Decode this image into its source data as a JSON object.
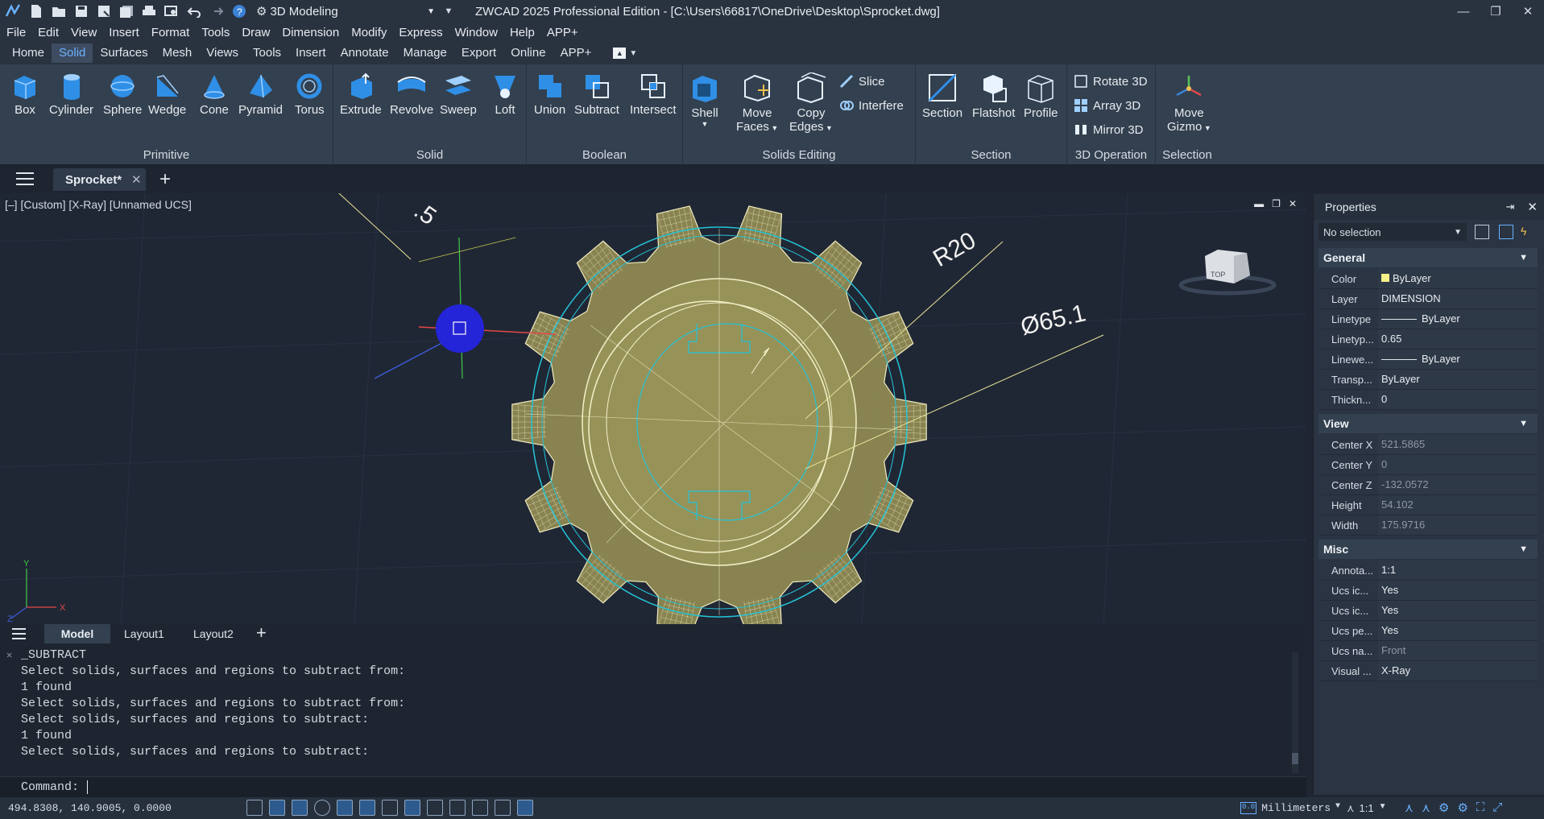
{
  "titlebar": {
    "workspace": "3D Modeling",
    "title": "ZWCAD 2025 Professional Edition - [C:\\Users\\66817\\OneDrive\\Desktop\\Sprocket.dwg]"
  },
  "menu": [
    "File",
    "Edit",
    "View",
    "Insert",
    "Format",
    "Tools",
    "Draw",
    "Dimension",
    "Modify",
    "Express",
    "Window",
    "Help",
    "APP+"
  ],
  "ribbon_tabs": [
    "Home",
    "Solid",
    "Surfaces",
    "Mesh",
    "Views",
    "Tools",
    "Insert",
    "Annotate",
    "Manage",
    "Export",
    "Online",
    "APP+"
  ],
  "ribbon": {
    "primitive": {
      "title": "Primitive",
      "tools": [
        "Box",
        "Cylinder",
        "Sphere",
        "Wedge",
        "Cone",
        "Pyramid",
        "Torus"
      ]
    },
    "solid": {
      "title": "Solid",
      "tools": [
        "Extrude",
        "Revolve",
        "Sweep",
        "Loft"
      ]
    },
    "boolean": {
      "title": "Boolean",
      "tools": [
        "Union",
        "Subtract",
        "Intersect"
      ]
    },
    "solids_editing": {
      "title": "Solids Editing",
      "shell": "Shell",
      "move": "Move",
      "faces": "Faces",
      "copy": "Copy",
      "edges": "Edges",
      "slice": "Slice",
      "interfere": "Interfere"
    },
    "section": {
      "title": "Section",
      "tools": [
        "Section",
        "Flatshot",
        "Profile"
      ]
    },
    "op3d": {
      "title": "3D Operation",
      "tools": [
        "Rotate 3D",
        "Array 3D",
        "Mirror 3D"
      ]
    },
    "selection": {
      "title": "Selection",
      "move": "Move",
      "gizmo": "Gizmo"
    }
  },
  "doc_tab": "Sprocket*",
  "viewport": {
    "label": "[–] [Custom] [X-Ray] [Unnamed UCS]",
    "dim_r": "R20",
    "dim_d": "Ø65.1",
    "viewcube": "TOP",
    "axis_x": "X",
    "axis_y": "Y",
    "axis_z": "Z"
  },
  "layout_tabs": [
    "Model",
    "Layout1",
    "Layout2"
  ],
  "command": {
    "history": [
      "_SUBTRACT",
      "Select solids, surfaces and regions to subtract from:",
      "1 found",
      "Select solids, surfaces and regions to subtract from:",
      "Select solids, surfaces and regions to subtract:",
      "1 found",
      "Select solids, surfaces and regions to subtract:"
    ],
    "prompt": "Command:"
  },
  "properties": {
    "title": "Properties",
    "selection": "No selection",
    "general": {
      "label": "General",
      "rows": [
        {
          "name": "Color",
          "value": "ByLayer"
        },
        {
          "name": "Layer",
          "value": "DIMENSION"
        },
        {
          "name": "Linetype",
          "value": "ByLayer"
        },
        {
          "name": "Linetyp...",
          "value": "0.65"
        },
        {
          "name": "Linewe...",
          "value": "ByLayer"
        },
        {
          "name": "Transp...",
          "value": "ByLayer"
        },
        {
          "name": "Thickn...",
          "value": "0"
        }
      ]
    },
    "view": {
      "label": "View",
      "rows": [
        {
          "name": "Center X",
          "value": "521.5865"
        },
        {
          "name": "Center Y",
          "value": "0"
        },
        {
          "name": "Center Z",
          "value": "-132.0572"
        },
        {
          "name": "Height",
          "value": "54.102"
        },
        {
          "name": "Width",
          "value": "175.9716"
        }
      ]
    },
    "misc": {
      "label": "Misc",
      "rows": [
        {
          "name": "Annota...",
          "value": "1:1"
        },
        {
          "name": "Ucs ic...",
          "value": "Yes"
        },
        {
          "name": "Ucs ic...",
          "value": "Yes"
        },
        {
          "name": "Ucs pe...",
          "value": "Yes"
        },
        {
          "name": "Ucs na...",
          "value": "Front"
        },
        {
          "name": "Visual ...",
          "value": "X-Ray"
        }
      ]
    }
  },
  "status": {
    "coords": "494.8308, 140.9005, 0.0000",
    "units": "Millimeters",
    "scale": "1:1"
  },
  "colors": {
    "accent": "#6bb1ff",
    "solid": "#c9bd6a",
    "wire": "#f4f0c8",
    "cyan": "#23c4d8"
  }
}
